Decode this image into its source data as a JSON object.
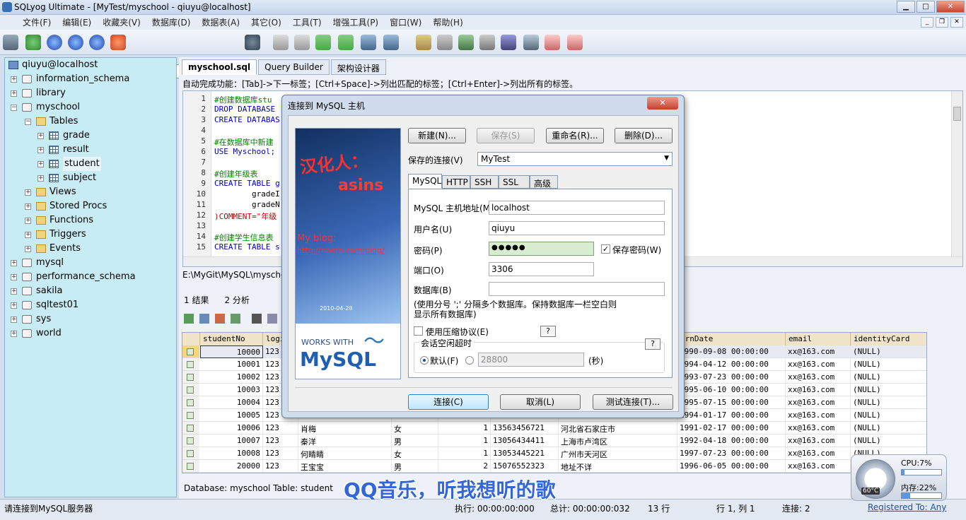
{
  "window": {
    "title": "SQLyog Ultimate - [MyTest/myschool - qiuyu@localhost]",
    "btn_min": "▁",
    "btn_max": "□",
    "btn_close": "✕"
  },
  "menu": [
    "文件(F)",
    "编辑(E)",
    "收藏夹(V)",
    "数据库(D)",
    "数据表(A)",
    "其它(O)",
    "工具(T)",
    "增强工具(P)",
    "窗口(W)",
    "帮助(H)"
  ],
  "toolbar": {
    "db_select": "myschool"
  },
  "tree": {
    "root": "qiuyu@localhost",
    "dbs": [
      "information_schema",
      "library",
      "myschool"
    ],
    "folders": {
      "tables": "Tables",
      "views": "Views",
      "procs": "Stored Procs",
      "functions": "Functions",
      "triggers": "Triggers",
      "events": "Events"
    },
    "tables": [
      "grade",
      "result",
      "student",
      "subject"
    ],
    "other_dbs": [
      "mysql",
      "performance_schema",
      "sakila",
      "sqltest01",
      "sys",
      "world"
    ]
  },
  "tabs": [
    "myschool.sql",
    "Query Builder",
    "架构设计器"
  ],
  "hint": "自动完成功能：[Tab]->下一标签；[Ctrl+Space]->列出匹配的标签；[Ctrl+Enter]->列出所有的标签。",
  "editor": {
    "lines": [
      "1",
      "2",
      "3",
      "4",
      "5",
      "6",
      "7",
      "8",
      "9",
      "10",
      "11",
      "12",
      "13",
      "14",
      "15"
    ],
    "code": [
      "#创建数据库stu",
      "DROP DATABASE",
      "CREATE DATABAS",
      "",
      "#在数据库中新建",
      "USE Myschool;",
      "",
      "#创建年级表",
      "CREATE TABLE g",
      "        gradeI",
      "        gradeN",
      ")COMMENT=\"年级",
      "",
      "#创建学生信息表",
      "CREATE TABLE s"
    ]
  },
  "path": "E:\\MyGit\\MySQL\\myscho",
  "result_tabs": [
    "1 结果",
    "2 分析"
  ],
  "grid": {
    "headers": [
      "studentNo",
      "logi",
      "",
      "",
      "",
      "",
      "",
      "ornDate",
      "email",
      "identityCard"
    ],
    "rows": [
      {
        "no": "10000",
        "pw": "123",
        "name": "",
        "sex": "",
        "grade": "",
        "phone": "",
        "addr": "",
        "born": "1990-09-08 00:00:00",
        "email": "xx@163.com",
        "id": "(NULL)"
      },
      {
        "no": "10001",
        "pw": "123",
        "name": "",
        "sex": "",
        "grade": "",
        "phone": "",
        "addr": "",
        "born": "1994-04-12 00:00:00",
        "email": "xx@163.com",
        "id": "(NULL)"
      },
      {
        "no": "10002",
        "pw": "123",
        "name": "",
        "sex": "",
        "grade": "",
        "phone": "",
        "addr": "",
        "born": "1993-07-23 00:00:00",
        "email": "xx@163.com",
        "id": "(NULL)"
      },
      {
        "no": "10003",
        "pw": "123",
        "name": "",
        "sex": "",
        "grade": "",
        "phone": "",
        "addr": "",
        "born": "1995-06-10 00:00:00",
        "email": "xx@163.com",
        "id": "(NULL)"
      },
      {
        "no": "10004",
        "pw": "123",
        "name": "",
        "sex": "",
        "grade": "",
        "phone": "",
        "addr": "",
        "born": "1995-07-15 00:00:00",
        "email": "xx@163.com",
        "id": "(NULL)"
      },
      {
        "no": "10005",
        "pw": "123",
        "name": "",
        "sex": "",
        "grade": "",
        "phone": "",
        "addr": "",
        "born": "1994-01-17 00:00:00",
        "email": "xx@163.com",
        "id": "(NULL)"
      },
      {
        "no": "10006",
        "pw": "123",
        "name": "肖梅",
        "sex": "女",
        "grade": "1",
        "phone": "13563456721",
        "addr": "河北省石家庄市",
        "born": "1991-02-17 00:00:00",
        "email": "xx@163.com",
        "id": "(NULL)"
      },
      {
        "no": "10007",
        "pw": "123",
        "name": "秦洋",
        "sex": "男",
        "grade": "1",
        "phone": "13056434411",
        "addr": "上海市卢湾区",
        "born": "1992-04-18 00:00:00",
        "email": "xx@163.com",
        "id": "(NULL)"
      },
      {
        "no": "10008",
        "pw": "123",
        "name": "何睛睛",
        "sex": "女",
        "grade": "1",
        "phone": "13053445221",
        "addr": "广州市天河区",
        "born": "1997-07-23 00:00:00",
        "email": "xx@163.com",
        "id": "(NULL)"
      },
      {
        "no": "20000",
        "pw": "123",
        "name": "王宝宝",
        "sex": "男",
        "grade": "2",
        "phone": "15076552323",
        "addr": "地址不详",
        "born": "1996-06-05 00:00:00",
        "email": "xx@163.com",
        "id": "(NULL)"
      }
    ]
  },
  "dbinfo": "Database: myschool Table: student",
  "status": {
    "left": "请连接到MySQL服务器",
    "exec": "执行: 00:00:00:000",
    "total": "总计: 00:00:00:032",
    "rows": "13 行",
    "pos": "行 1, 列 1",
    "conn": "连接: 2",
    "reg": "Registered To: Any"
  },
  "overlay": "QQ音乐，听我想听的歌",
  "gadget": {
    "cpu": "CPU:7%",
    "cpu_pct": 0.07,
    "mem": "内存:22%",
    "mem_pct": 0.22,
    "temp": "60°C"
  },
  "dialog": {
    "title": "连接到 MySQL 主机",
    "close": "✕",
    "banner": {
      "t1": "汉化人：",
      "t2": "asins",
      "t3": "My blog:",
      "t4": "http://nootn.com/blog/",
      "date": "2010-04-28",
      "works": "WORKS WITH",
      "mysql": "MySQL"
    },
    "buttons": {
      "new": "新建(N)...",
      "save": "保存(S)",
      "rename": "重命名(R)...",
      "delete": "删除(D)..."
    },
    "saved_label": "保存的连接(V)",
    "saved_value": "MyTest",
    "tabs": [
      "MySQL",
      "HTTP",
      "SSH",
      "SSL",
      "高级"
    ],
    "host_label": "MySQL 主机地址(M)",
    "host": "localhost",
    "user_label": "用户名(U)",
    "user": "qiuyu",
    "pw_label": "密码(P)",
    "pw": "●●●●●",
    "save_pw": "保存密码(W)",
    "port_label": "端口(O)",
    "port": "3306",
    "db_label": "数据库(B)",
    "db": "",
    "note": "(使用分号 ';' 分隔多个数据库。保持数据库一栏空白则\n显示所有数据库)",
    "compress": "使用压缩协议(E)",
    "timeout_group": "会话空闲超时",
    "default": "默认(F)",
    "timeout": "28800",
    "sec": "(秒)",
    "help": "?",
    "connect": "连接(C)",
    "cancel": "取消(L)",
    "test": "测试连接(T)..."
  }
}
